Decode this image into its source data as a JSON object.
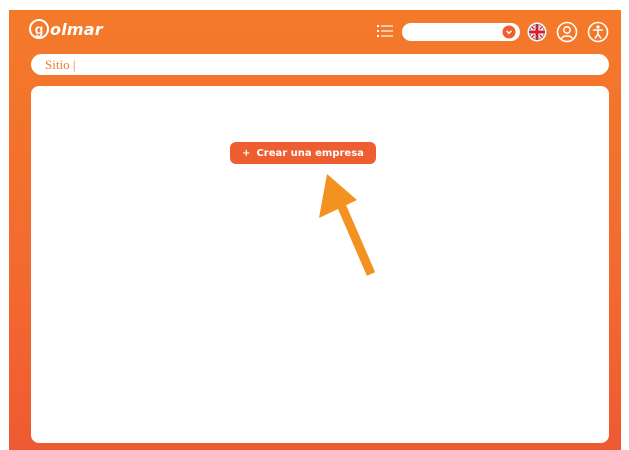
{
  "header": {
    "logo_text": "olmar",
    "logo_letter": "g",
    "site_select_value": "",
    "language_icon": "uk-flag-icon",
    "menu_icon": "list-icon",
    "user_icon": "user-icon",
    "access_icon": "accessibility-icon"
  },
  "site_bar": {
    "label": "Sitio |"
  },
  "main": {
    "create_button_plus": "+",
    "create_button_label": "Crear una empresa"
  },
  "colors": {
    "brand": "#f47a2a",
    "button": "#ef5e30",
    "arrow": "#f39220"
  }
}
